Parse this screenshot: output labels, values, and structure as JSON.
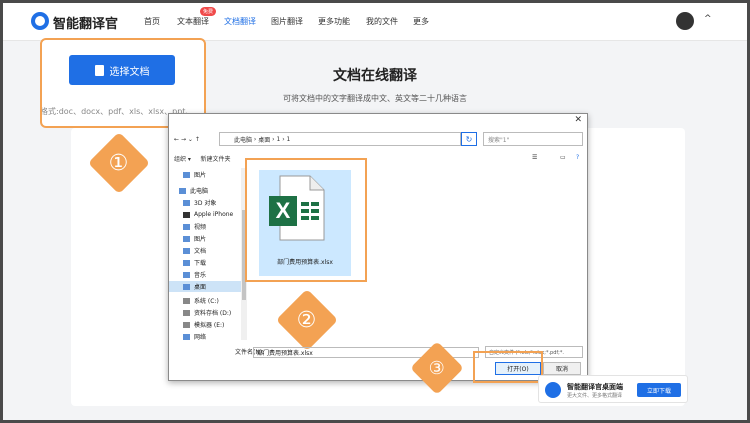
{
  "brand": "智能翻译官",
  "nav": [
    {
      "label": "首页"
    },
    {
      "label": "文本翻译"
    },
    {
      "label": "文档翻译"
    },
    {
      "label": "图片翻译"
    },
    {
      "label": "更多功能"
    },
    {
      "label": "我的文件"
    },
    {
      "label": "更多"
    }
  ],
  "nav_badge": "免费",
  "hero": {
    "title": "文档在线翻译",
    "subtitle": "可将文档中的文字翻译成中文、英文等二十几种语言"
  },
  "upload": {
    "button": "选择文档",
    "formats": "格式:doc、docx、pdf、xls、xlsx、ppt、"
  },
  "steps": [
    "①",
    "②",
    "③"
  ],
  "dialog": {
    "breadcrumb": [
      "此电脑",
      "桌面",
      "1",
      "1"
    ],
    "search_placeholder": "搜索\"1\"",
    "organize": "组织 ▾",
    "new_folder": "新建文件夹",
    "sidebar": [
      {
        "label": "图片"
      },
      {
        "label": "此电脑"
      },
      {
        "label": "3D 对象"
      },
      {
        "label": "Apple iPhone"
      },
      {
        "label": "视频"
      },
      {
        "label": "图片"
      },
      {
        "label": "文档"
      },
      {
        "label": "下载"
      },
      {
        "label": "音乐"
      },
      {
        "label": "桌面"
      },
      {
        "label": "系统 (C:)"
      },
      {
        "label": "资料存档 (D:)"
      },
      {
        "label": "模拟器 (E:)"
      },
      {
        "label": "网络"
      }
    ],
    "file_name": "部门费用预算表.xlsx",
    "file_name_label": "文件名(N):",
    "file_name_value": "部门费用预算表.xlsx",
    "file_type": "自定义文件 (*.xls;*.xlsx;*.pdf;*.",
    "open": "打开(O)",
    "cancel": "取消"
  },
  "promo": {
    "title": "智能翻译官桌面端",
    "desc": "更大文件、更多格式翻译",
    "button": "立即下载"
  },
  "colors": {
    "primary": "#1f6fe5",
    "callout": "#f3a253",
    "excel": "#1e7145"
  }
}
